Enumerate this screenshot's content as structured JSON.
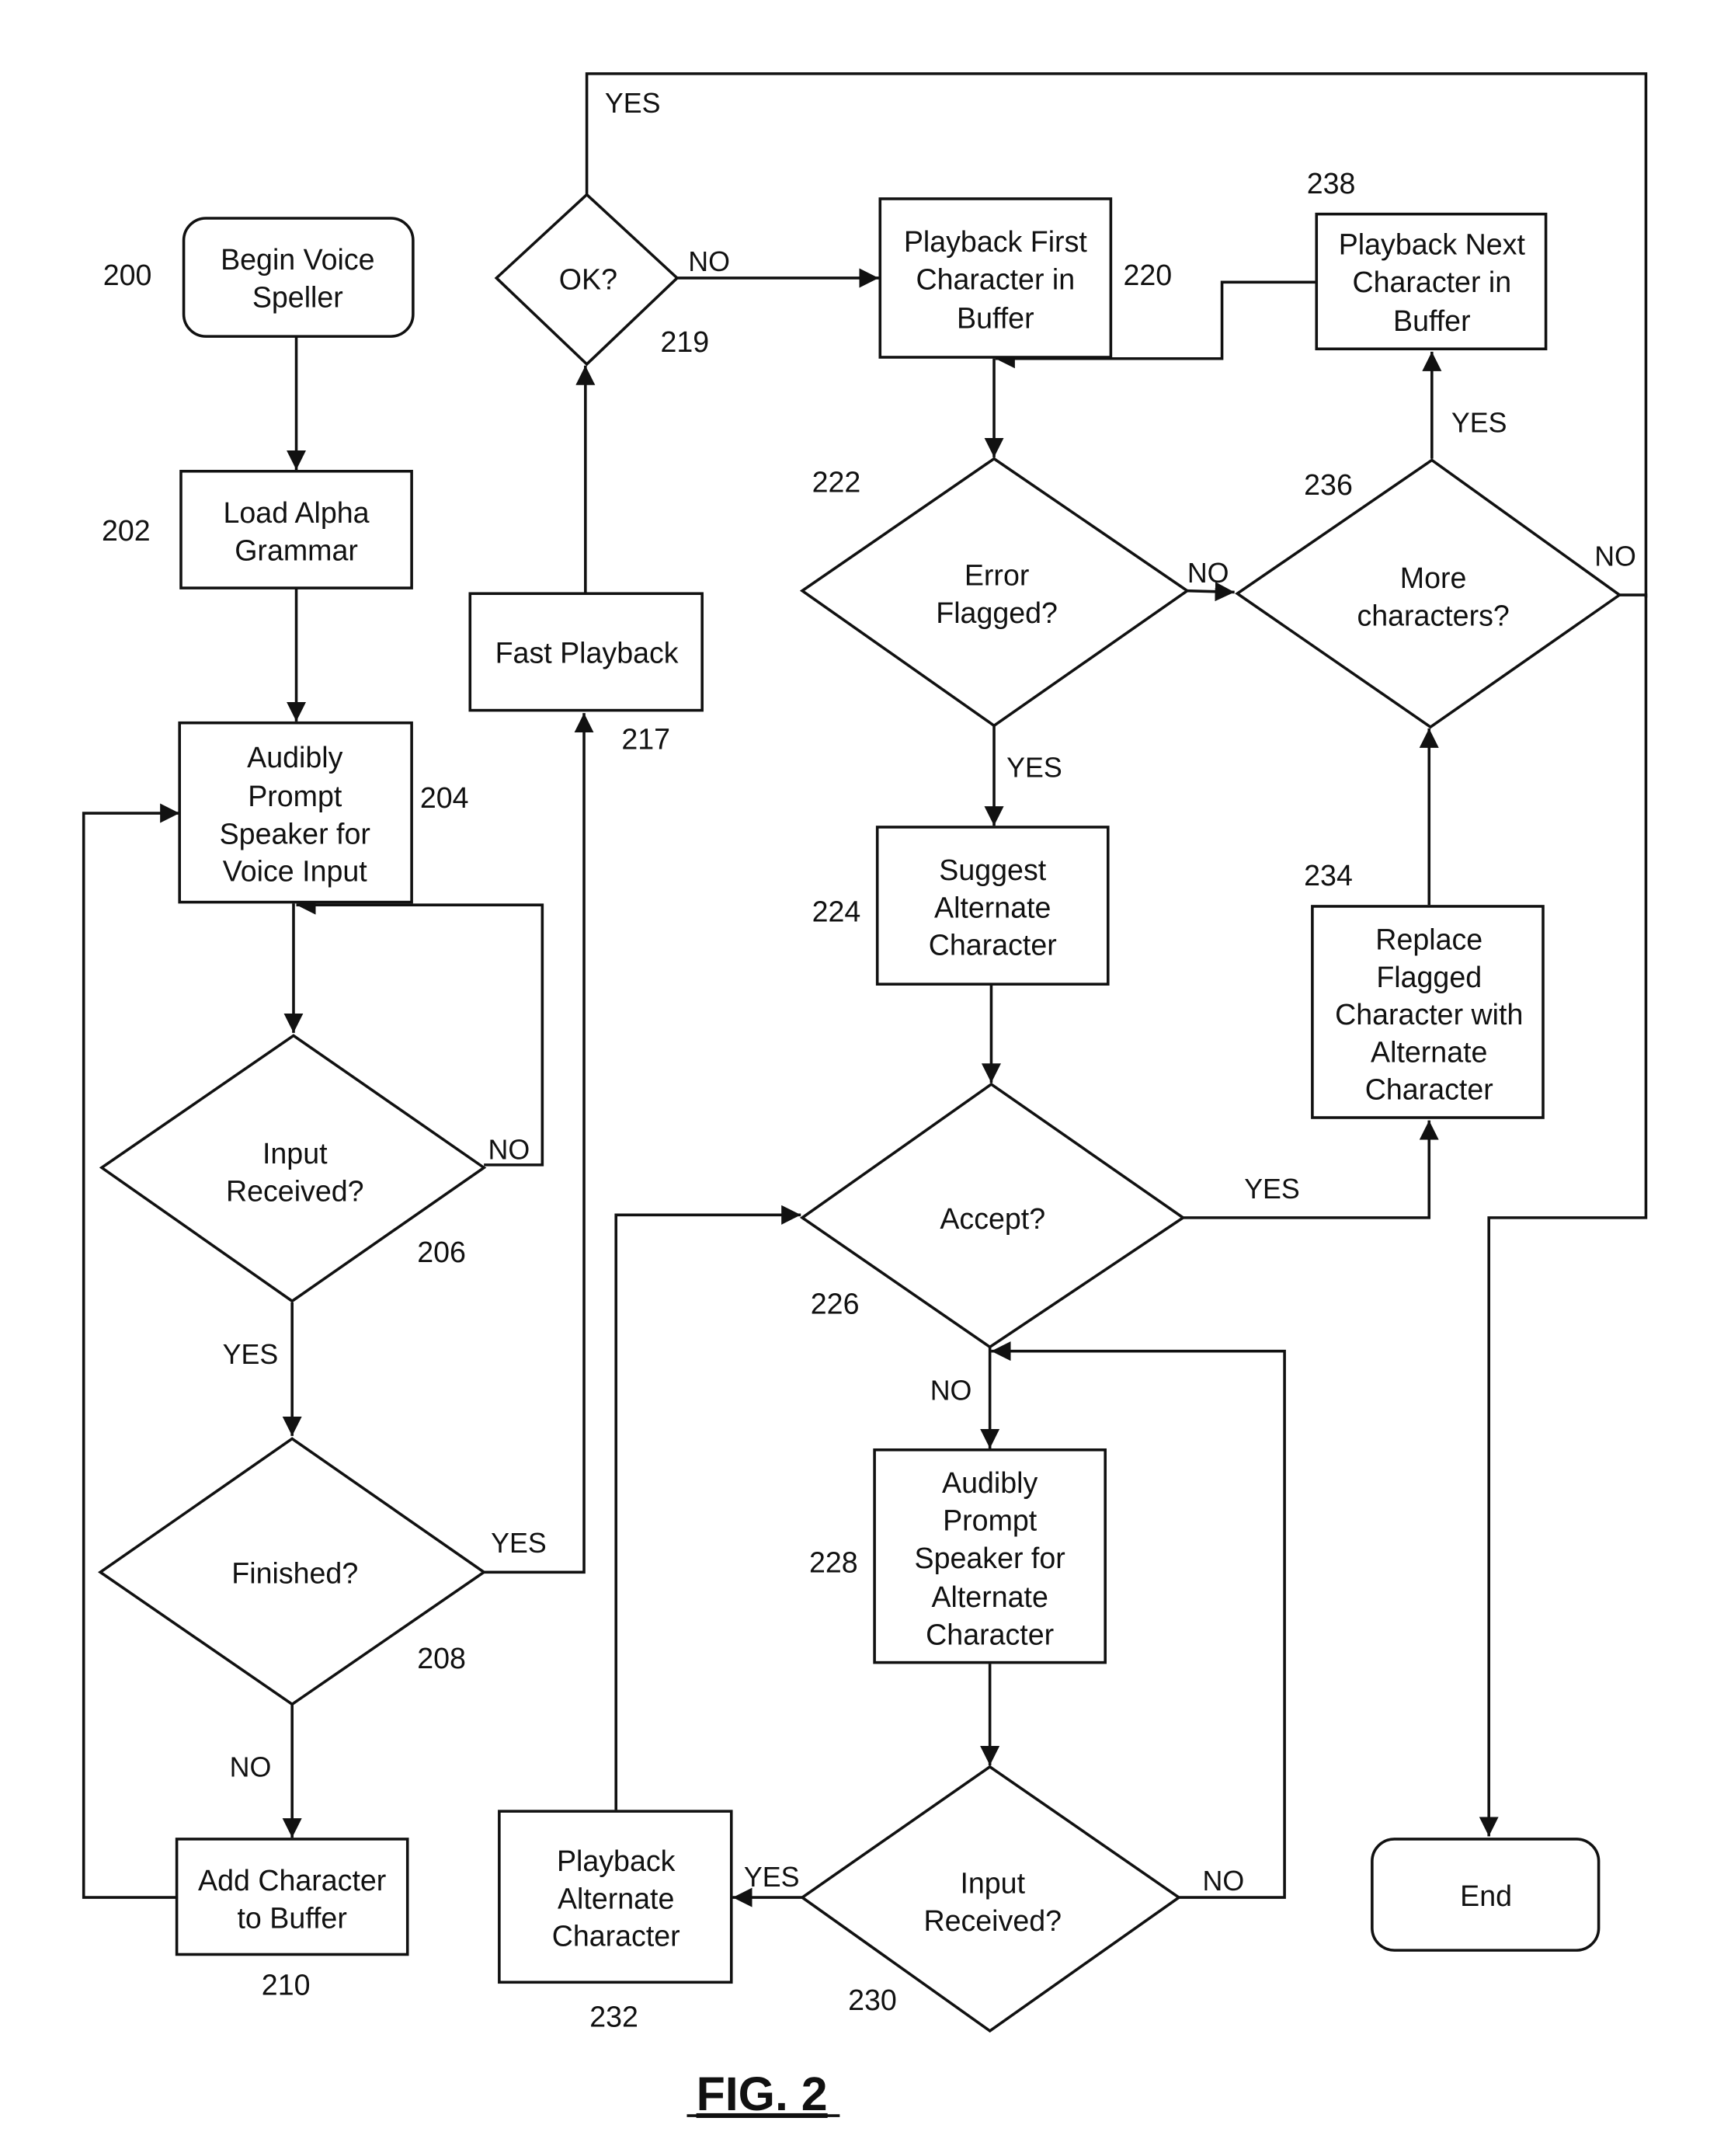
{
  "figure_label": "FIG. 2",
  "nodes": {
    "n200": {
      "ref": "200",
      "lines": [
        "Begin Voice",
        "Speller"
      ],
      "type": "terminal"
    },
    "n202": {
      "ref": "202",
      "lines": [
        "Load Alpha",
        "Grammar"
      ],
      "type": "process"
    },
    "n204": {
      "ref": "204",
      "lines": [
        "Audibly",
        "Prompt",
        "Speaker for",
        "Voice Input"
      ],
      "type": "process"
    },
    "n206": {
      "ref": "206",
      "lines": [
        "Input",
        "Received?"
      ],
      "type": "decision"
    },
    "n208": {
      "ref": "208",
      "lines": [
        "Finished?"
      ],
      "type": "decision"
    },
    "n210": {
      "ref": "210",
      "lines": [
        "Add Character",
        "to Buffer"
      ],
      "type": "process"
    },
    "n217": {
      "ref": "217",
      "lines": [
        "Fast Playback"
      ],
      "type": "process"
    },
    "n219": {
      "ref": "219",
      "lines": [
        "OK?"
      ],
      "type": "decision"
    },
    "n220": {
      "ref": "220",
      "lines": [
        "Playback First",
        "Character in",
        "Buffer"
      ],
      "type": "process"
    },
    "n222": {
      "ref": "222",
      "lines": [
        "Error",
        "Flagged?"
      ],
      "type": "decision"
    },
    "n224": {
      "ref": "224",
      "lines": [
        "Suggest",
        "Alternate",
        "Character"
      ],
      "type": "process"
    },
    "n226": {
      "ref": "226",
      "lines": [
        "Accept?"
      ],
      "type": "decision"
    },
    "n228": {
      "ref": "228",
      "lines": [
        "Audibly",
        "Prompt",
        "Speaker for",
        "Alternate",
        "Character"
      ],
      "type": "process"
    },
    "n230": {
      "ref": "230",
      "lines": [
        "Input",
        "Received?"
      ],
      "type": "decision"
    },
    "n232": {
      "ref": "232",
      "lines": [
        "Playback",
        "Alternate",
        "Character"
      ],
      "type": "process"
    },
    "n234": {
      "ref": "234",
      "lines": [
        "Replace",
        "Flagged",
        "Character with",
        "Alternate",
        "Character"
      ],
      "type": "process"
    },
    "n236": {
      "ref": "236",
      "lines": [
        "More",
        "characters?"
      ],
      "type": "decision"
    },
    "n238": {
      "ref": "238",
      "lines": [
        "Playback Next",
        "Character in",
        "Buffer"
      ],
      "type": "process"
    },
    "end": {
      "lines": [
        "End"
      ],
      "type": "terminal"
    }
  },
  "edge_labels": {
    "e206_no": "NO",
    "e206_yes": "YES",
    "e208_yes": "YES",
    "e208_no": "NO",
    "e219_yes": "YES",
    "e219_no": "NO",
    "e222_no": "NO",
    "e222_yes": "YES",
    "e226_yes": "YES",
    "e226_no": "NO",
    "e230_yes": "YES",
    "e230_no": "NO",
    "e236_yes": "YES",
    "e236_no": "NO"
  }
}
